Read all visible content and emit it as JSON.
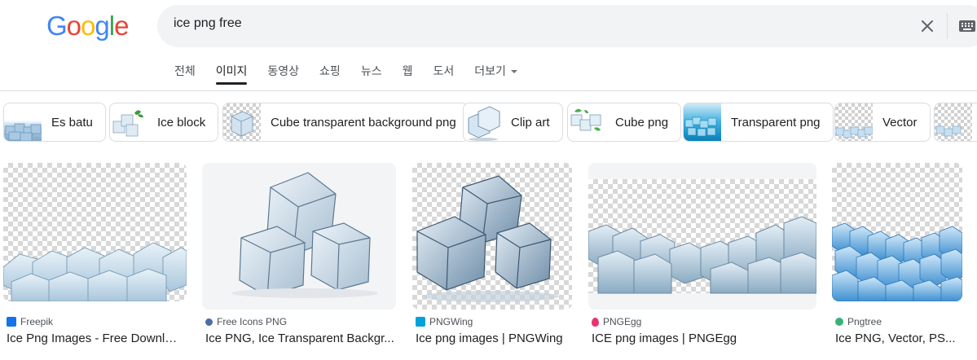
{
  "logo": {
    "letters": [
      "G",
      "o",
      "o",
      "g",
      "l",
      "e"
    ],
    "colors": [
      "#4285f4",
      "#ea4335",
      "#fbbc05",
      "#4285f4",
      "#34a853",
      "#ea4335"
    ]
  },
  "search": {
    "query": "ice png free",
    "clear_icon": "close-icon",
    "keyboard_icon": "keyboard-icon"
  },
  "tabs": [
    "전체",
    "이미지",
    "동영상",
    "쇼핑",
    "뉴스",
    "웹",
    "도서",
    "더보기"
  ],
  "active_tab": "이미지",
  "chips": [
    {
      "label": "Es batu"
    },
    {
      "label": "Ice block"
    },
    {
      "label": "Cube transparent background png"
    },
    {
      "label": "Clip art"
    },
    {
      "label": "Cube png"
    },
    {
      "label": "Transparent png"
    },
    {
      "label": "Vector"
    }
  ],
  "results": [
    {
      "source": "Freepik",
      "title": "Ice Png Images - Free Downlo...",
      "favicon_color": "#1273eb"
    },
    {
      "source": "Free Icons PNG",
      "title": "Ice PNG, Ice Transparent Backgr...",
      "favicon_color": "#4a6fa5"
    },
    {
      "source": "PNGWing",
      "title": "Ice png images | PNGWing",
      "favicon_color": "#00a2d9"
    },
    {
      "source": "PNGEgg",
      "title": "ICE png images | PNGEgg",
      "favicon_color": "#e8336f"
    },
    {
      "source": "Pngtree",
      "title": "Ice PNG, Vector, PS...",
      "favicon_color": "#38b27a"
    }
  ]
}
